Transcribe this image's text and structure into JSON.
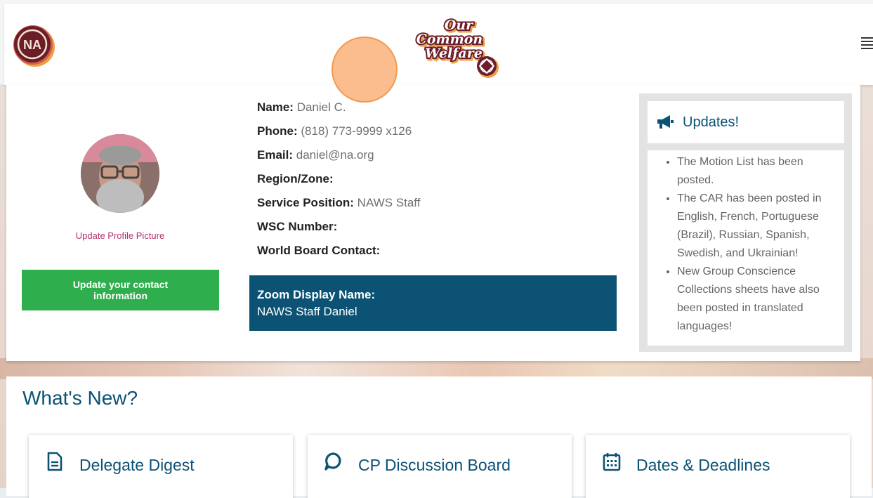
{
  "header": {
    "logo_left_text": "NA",
    "logo_center_lines": [
      "Our",
      "Common",
      "Welfare"
    ]
  },
  "profile": {
    "update_picture_link": "Update Profile Picture",
    "update_contact_button": "Update your contact information",
    "fields": [
      {
        "label": "Name:",
        "value": "Daniel C."
      },
      {
        "label": "Phone:",
        "value": "(818) 773-9999 x126"
      },
      {
        "label": "Email:",
        "value": "daniel@na.org"
      },
      {
        "label": "Region/Zone:",
        "value": ""
      },
      {
        "label": "Service Position:",
        "value": "NAWS Staff"
      },
      {
        "label": "WSC Number:",
        "value": ""
      },
      {
        "label": "World Board Contact:",
        "value": ""
      }
    ],
    "zoom": {
      "label": "Zoom Display Name:",
      "value": "NAWS Staff Daniel"
    }
  },
  "updates": {
    "title": "Updates!",
    "items": [
      "The Motion List has been posted.",
      "The CAR has been posted in English, French, Portuguese (Brazil), Russian, Spanish, Swedish, and Ukrainian!",
      "New Group Conscience Collections sheets have also been posted in translated languages!"
    ]
  },
  "whats_new": {
    "title": "What's New?",
    "cards": [
      {
        "label": "Delegate Digest",
        "icon": "document-icon"
      },
      {
        "label": "CP Discussion Board",
        "icon": "chat-bubble-icon"
      },
      {
        "label": "Dates & Deadlines",
        "icon": "calendar-icon"
      }
    ]
  },
  "colors": {
    "primary": "#0b5274",
    "button_green": "#2eae4c",
    "link_pink": "#b5306b",
    "logo_maroon": "#6b1d2a",
    "logo_orange": "#f0a040"
  }
}
